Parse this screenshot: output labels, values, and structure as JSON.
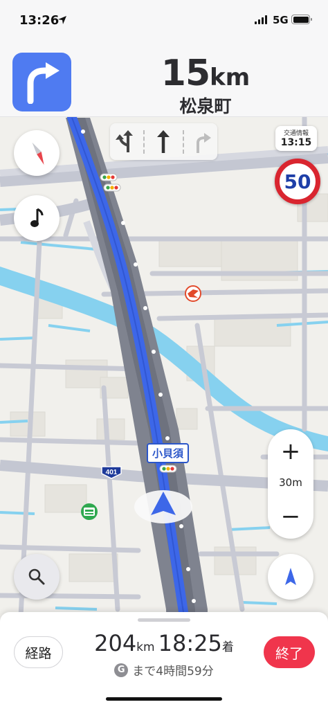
{
  "status_bar": {
    "time": "13:26",
    "network": "5G",
    "icons": [
      "location-arrow-icon",
      "cellular-signal-icon",
      "battery-icon"
    ]
  },
  "nav_banner": {
    "turn_icon": "turn-right-arrow-icon",
    "distance_value": "15",
    "distance_unit": "km",
    "street_name": "松泉町"
  },
  "lanes": [
    {
      "icon": "lane-left-straight-icon",
      "active": false
    },
    {
      "icon": "lane-straight-icon",
      "active": true
    },
    {
      "icon": "lane-right-icon",
      "active": false
    }
  ],
  "traffic_info": {
    "label": "交通情報",
    "time": "13:15"
  },
  "speed_limit": "50",
  "map": {
    "place_label": "小貝須",
    "route_number": "401",
    "icons": [
      "compass-icon",
      "music-note-icon",
      "poi-brand-icon",
      "poi-station-icon",
      "traffic-light-icon",
      "current-position-icon",
      "search-icon",
      "locate-me-icon"
    ]
  },
  "zoom": {
    "in_label": "+",
    "scale": "30m",
    "out_label": "−"
  },
  "bottom_panel": {
    "route_button": "経路",
    "distance_value": "204",
    "distance_unit": "km",
    "arrival_time": "18:25",
    "arrival_suffix": "着",
    "remaining": "まで4時間59分",
    "end_button": "終了",
    "badge_letter": "G"
  },
  "colors": {
    "route_blue": "#3d67e8",
    "turn_tile": "#4f7bf1",
    "end_button": "#f0354c",
    "speed_sign_border": "#d9252f",
    "water": "#86d1ef"
  }
}
